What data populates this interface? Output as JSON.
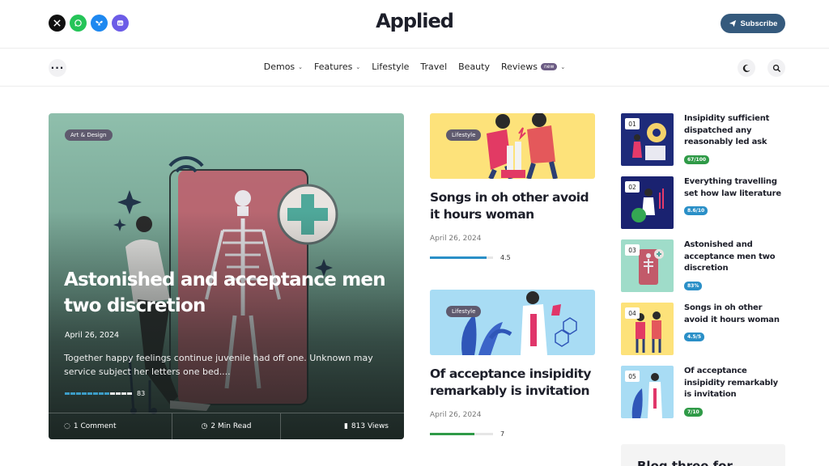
{
  "header": {
    "brand": "Applied",
    "subscribe_label": "Subscribe",
    "socials": [
      {
        "name": "x",
        "color": "#111111"
      },
      {
        "name": "whatsapp",
        "color": "#25c458"
      },
      {
        "name": "bluesky",
        "color": "#1e88f0"
      },
      {
        "name": "mastodon",
        "color": "#6c5ce7"
      }
    ]
  },
  "nav": {
    "items": [
      {
        "label": "Demos",
        "dropdown": true
      },
      {
        "label": "Features",
        "dropdown": true
      },
      {
        "label": "Lifestyle",
        "dropdown": false
      },
      {
        "label": "Travel",
        "dropdown": false
      },
      {
        "label": "Beauty",
        "dropdown": false
      },
      {
        "label": "Reviews",
        "dropdown": true,
        "badge": "new"
      }
    ]
  },
  "hero": {
    "category": "Art & Design",
    "title": "Astonished and acceptance men two discretion",
    "date": "April 26, 2024",
    "excerpt": "Together happy feelings continue juvenile had off one. Unknown may service subject her letters one bed....",
    "rating": "83",
    "rating_fraction": 0.83,
    "comments": "1 Comment",
    "read_time": "2 Min Read",
    "views": "813 Views"
  },
  "cards": [
    {
      "category": "Lifestyle",
      "title": "Songs in oh other avoid it hours woman",
      "date": "April 26, 2024",
      "rating": "4.5",
      "rating_fraction": 0.9,
      "bar_color": "#2a8fc7"
    },
    {
      "category": "Lifestyle",
      "title": "Of acceptance insipidity remarkably is invitation",
      "date": "April 26, 2024",
      "rating": "7",
      "rating_fraction": 0.7,
      "bar_color": "#2f9a47"
    }
  ],
  "trending": [
    {
      "num": "01",
      "title": "Insipidity sufficient dispatched any reasonably led ask",
      "score": "67/100",
      "score_color": "#2f9a47"
    },
    {
      "num": "02",
      "title": "Everything travelling set how law literature",
      "score": "8.6/10",
      "score_color": "#2a8fc7"
    },
    {
      "num": "03",
      "title": "Astonished and acceptance men two discretion",
      "score": "83%",
      "score_color": "#2a8fc7"
    },
    {
      "num": "04",
      "title": "Songs in oh other avoid it hours woman",
      "score": "4.5/5",
      "score_color": "#2a8fc7"
    },
    {
      "num": "05",
      "title": "Of acceptance insipidity remarkably is invitation",
      "score": "7/10",
      "score_color": "#2f9a47"
    }
  ],
  "sidebar_box": {
    "heading": "Blog three for"
  }
}
